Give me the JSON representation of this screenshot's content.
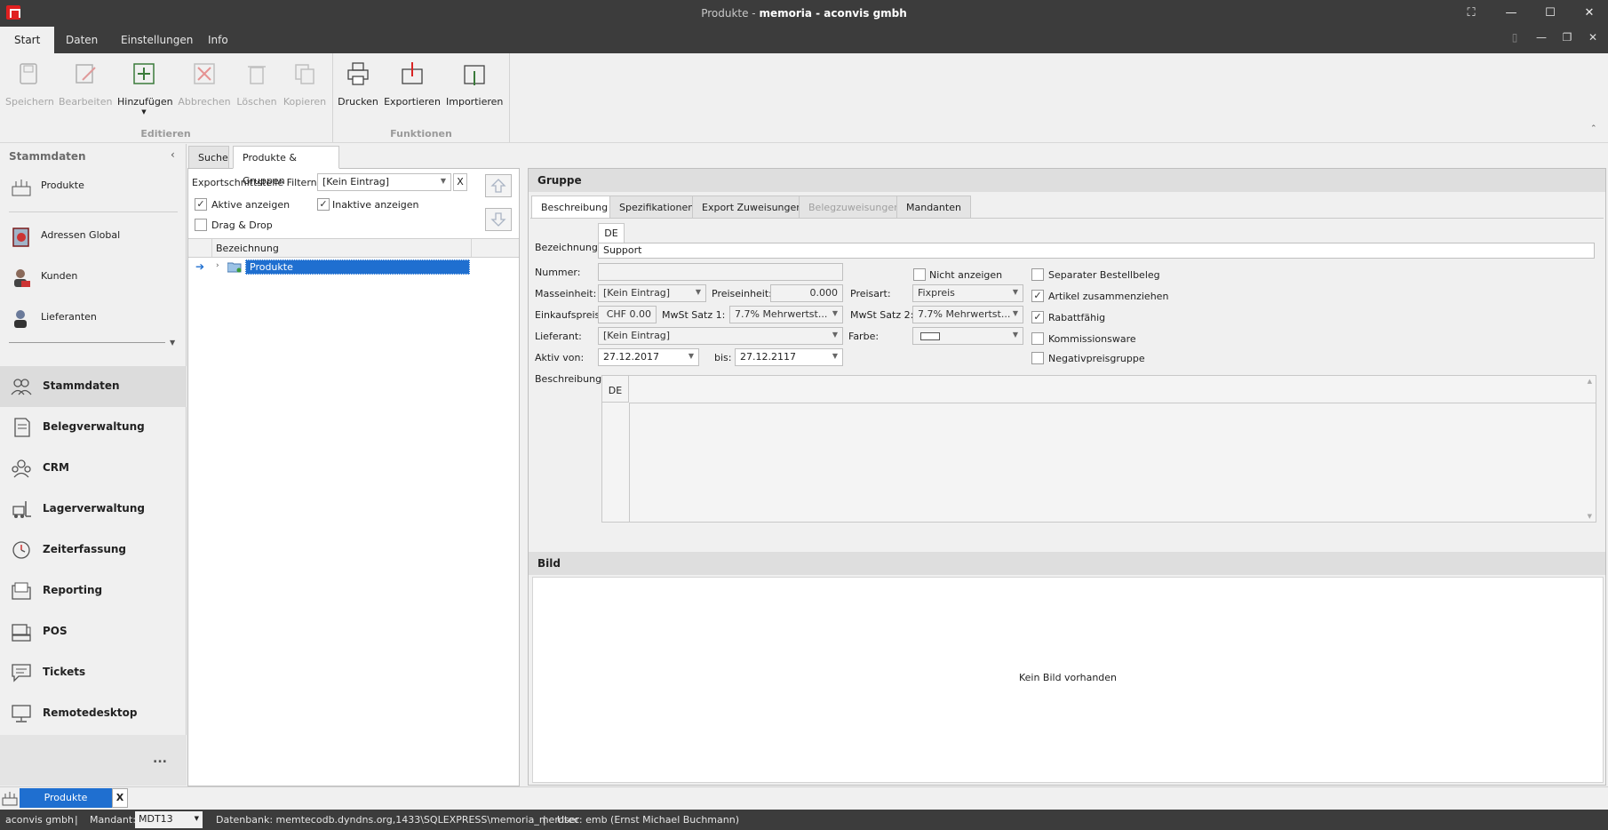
{
  "window": {
    "title_prefix": "Produkte",
    "title_sep": " - ",
    "title_main": "memoria - aconvis gmbh"
  },
  "menu": {
    "tabs": [
      "Start",
      "Daten",
      "Einstellungen",
      "Info"
    ]
  },
  "ribbon": {
    "buttons": [
      "Speichern",
      "Bearbeiten",
      "Hinzufügen",
      "Abbrechen",
      "Löschen",
      "Kopieren",
      "Drucken",
      "Exportieren",
      "Importieren"
    ],
    "groups": [
      "Editieren",
      "Funktionen"
    ]
  },
  "leftnav": {
    "header": "Stammdaten",
    "items": [
      "Produkte",
      "Adressen Global",
      "Kunden",
      "Lieferanten"
    ],
    "modules": [
      "Stammdaten",
      "Belegverwaltung",
      "CRM",
      "Lagerverwaltung",
      "Zeiterfassung",
      "Reporting",
      "POS",
      "Tickets",
      "Remotedesktop"
    ],
    "more": "..."
  },
  "tree": {
    "tabs": [
      "Suche",
      "Produkte & Gruppen"
    ],
    "filter_label": "Exportschnittstelle Filtern:",
    "filter_value": "[Kein Eintrag]",
    "filter_clear": "X",
    "show_active": "Aktive anzeigen",
    "show_inactive": "Inaktive anzeigen",
    "drag_drop": "Drag & Drop",
    "column": "Bezeichnung",
    "row": "Produkte"
  },
  "detail": {
    "header": "Gruppe",
    "tabs": [
      "Beschreibung",
      "Spezifikationen",
      "Export Zuweisungen",
      "Belegzuweisungen",
      "Mandanten"
    ],
    "bezeichnung_label": "Bezeichnung:",
    "lang_tab": "DE",
    "bezeichnung_value": "Support",
    "nummer_label": "Nummer:",
    "masseinheit_label": "Masseinheit:",
    "masseinheit_value": "[Kein Eintrag]",
    "preiseinheit_label": "Preiseinheit:",
    "preiseinheit_value": "0.000",
    "preisart_label": "Preisart:",
    "preisart_value": "Fixpreis",
    "einkaufspreis_label": "Einkaufspreis:",
    "einkaufspreis_value": "CHF 0.00",
    "mwst1_label": "MwSt Satz 1:",
    "mwst1_value": "7.7% Mehrwertst...",
    "mwst2_label": "MwSt Satz 2:",
    "mwst2_value": "7.7% Mehrwertst...",
    "lieferant_label": "Lieferant:",
    "lieferant_value": "[Kein Eintrag]",
    "farbe_label": "Farbe:",
    "aktiv_von_label": "Aktiv von:",
    "aktiv_von_value": "27.12.2017",
    "bis_label": "bis:",
    "bis_value": "27.12.2117",
    "beschreibung_label": "Beschreibung:",
    "checks": {
      "nicht_anzeigen": "Nicht anzeigen",
      "separater": "Separater Bestellbeleg",
      "artikel_zus": "Artikel zusammenziehen",
      "rabattfaehig": "Rabattfähig",
      "kommission": "Kommissionsware",
      "negativpreis": "Negativpreisgruppe"
    },
    "bild_header": "Bild",
    "no_image": "Kein Bild vorhanden"
  },
  "doctab": {
    "label": "Produkte",
    "close": "X"
  },
  "status": {
    "company": "aconvis gmbh",
    "mandant_label": "Mandant:",
    "mandant_value": "MDT13",
    "database": "Datenbank: memtecodb.dyndns.org,1433\\SQLEXPRESS\\memoria_memtec",
    "user": "User: emb (Ernst Michael Buchmann)",
    "sep": "|"
  },
  "colors": {
    "accent": "#1f6fd0",
    "chrome": "#3c3c3c",
    "danger": "#d92424"
  }
}
